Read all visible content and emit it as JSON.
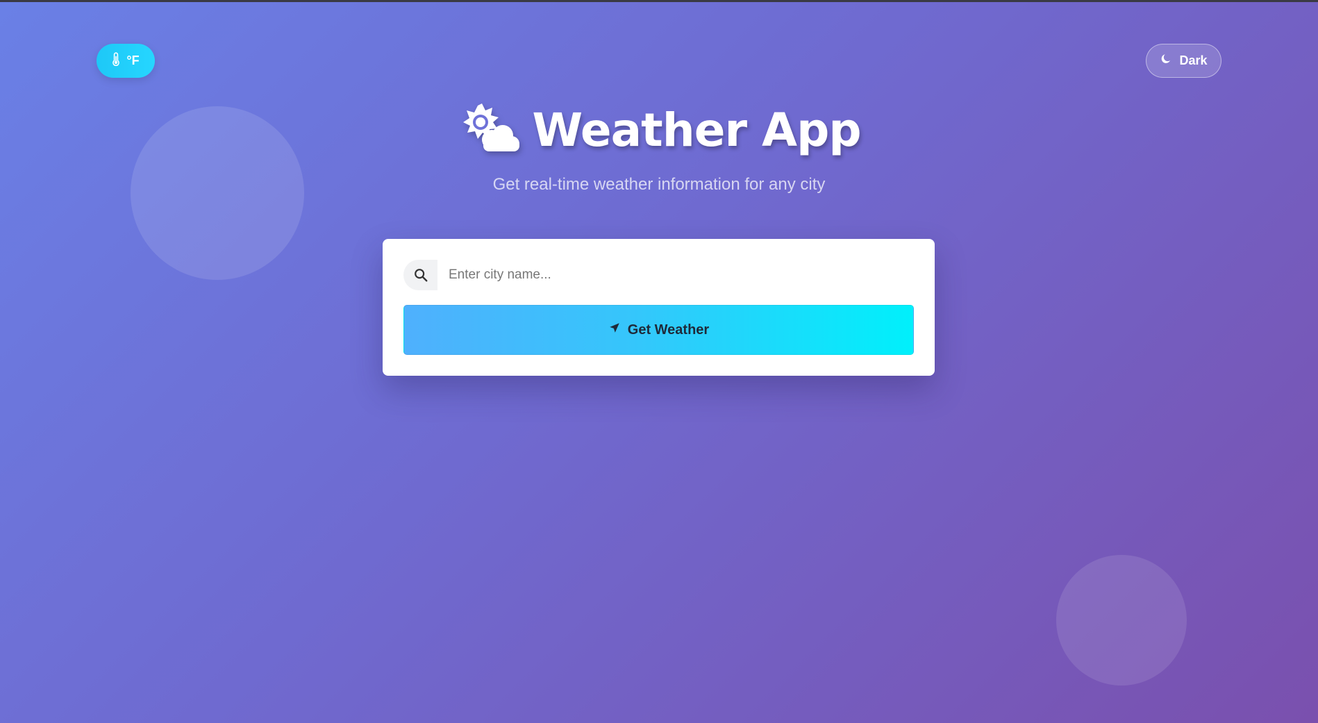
{
  "app": {
    "title": "Weather App",
    "subtitle": "Get real-time weather information for any city",
    "header_icon": "sun-behind-cloud-icon"
  },
  "controls": {
    "unit_toggle": {
      "label": "°F",
      "icon": "thermometer-icon"
    },
    "theme_toggle": {
      "label": "Dark",
      "icon": "moon-icon"
    }
  },
  "search": {
    "icon": "search-icon",
    "placeholder": "Enter city name...",
    "value": "",
    "button_label": "Get Weather",
    "button_icon": "location-arrow-icon"
  },
  "colors": {
    "background_start": "#6a80e6",
    "background_end": "#7a50ae",
    "unit_toggle_bg": "#1ec8f7",
    "button_gradient_start": "#4fb0fd",
    "button_gradient_end": "#00f0fb"
  }
}
